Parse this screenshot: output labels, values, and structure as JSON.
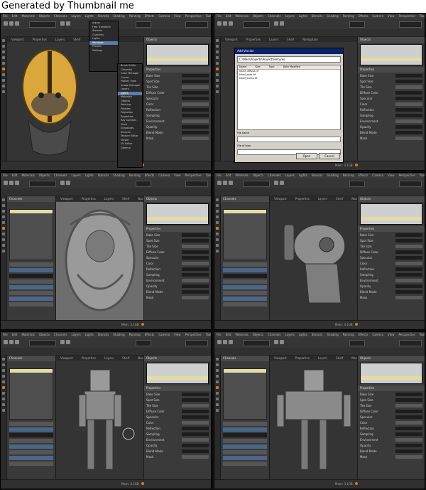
{
  "banner": {
    "text": "Generated by Thumbnail me"
  },
  "menu_items": [
    "File",
    "Edit",
    "Materials",
    "Objects",
    "Channels",
    "Layers",
    "Lights",
    "Stencils",
    "Shading",
    "Painting",
    "Effects",
    "Camera",
    "View",
    "Perspective",
    "Tools",
    "Help"
  ],
  "viewport_tabs": [
    "Viewport",
    "Properties",
    "Layers",
    "Shelf",
    "Navigation"
  ],
  "bottom_status": "Mem: 3.1GB",
  "dropdown": {
    "items": [
      "Adjust",
      "Free Transform",
      "Stencils",
      "Channels",
      "Lights",
      "Windows",
      "Presets",
      "Settings"
    ],
    "selected_index": 5
  },
  "submenu": {
    "items": [
      "Brush Editor",
      "Channels",
      "Color Manager",
      "Curves",
      "History View",
      "Image Manager",
      "Layers",
      "Lights",
      "Materials",
      "Objects",
      "Painting",
      "Palettes",
      "Projection",
      "Properties",
      "Ray Controls",
      "Shelf",
      "Snapshots",
      "Stencils",
      "Texture Editor",
      "Viewer",
      "UV Editor",
      "Gamma"
    ],
    "selected_index": 7
  },
  "dialog": {
    "title": "Add Version",
    "path": "C:\\Mari\\Projects\\Project\\Textures",
    "columns": [
      "Name",
      "Size",
      "Type",
      "Date Modified"
    ],
    "files": [
      "head_diffuse.tif",
      "head_spec.tif",
      "head_bump.tif"
    ],
    "filename_label": "File name",
    "filetype_label": "File of type",
    "open_button": "Open",
    "cancel_button": "Cancel"
  },
  "panel_header": "Channels",
  "object_panel_header": "Objects",
  "properties_header": "Properties",
  "properties_rows": [
    "Bake Size",
    "Spot Size",
    "Tile Size",
    "Diffuse Color",
    "Specular",
    "Color",
    "Reflection",
    "Sampling",
    "Environment",
    "Opacity",
    "Blend Mode",
    "Mask"
  ],
  "cells": [
    {
      "label": "cell-1",
      "scene": "alien-head-colored",
      "has_midpanel": false
    },
    {
      "label": "cell-2",
      "scene": "file-dialog",
      "has_midpanel": false
    },
    {
      "label": "cell-3",
      "scene": "sculpt-closeup",
      "has_midpanel": true
    },
    {
      "label": "cell-4",
      "scene": "mech-head-side",
      "has_midpanel": true
    },
    {
      "label": "cell-5",
      "scene": "robot-front",
      "has_midpanel": true
    },
    {
      "label": "cell-6",
      "scene": "robot-rear",
      "has_midpanel": true
    }
  ],
  "colors": {
    "ui_bg": "#2c2c2c",
    "accent": "#d87a1c",
    "selection": "#e3dca4",
    "head_yellow": "#d9a73a",
    "mesh_gray": "#9a9a9a"
  }
}
